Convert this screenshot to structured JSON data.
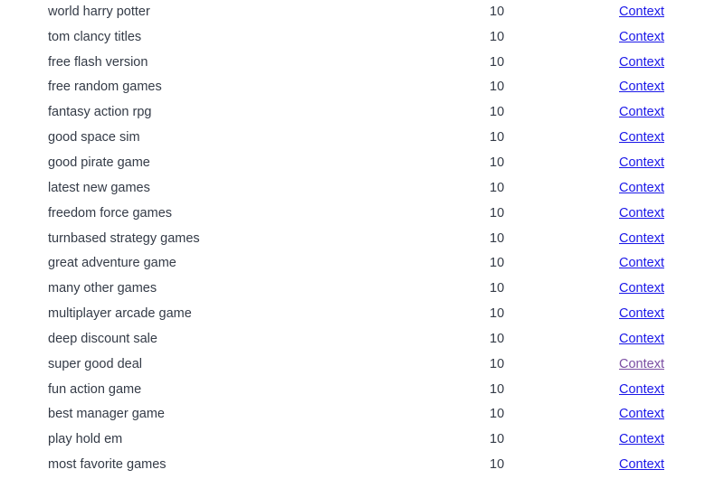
{
  "table": {
    "link_label": "Context",
    "link_color": "#1a17e8",
    "visited_link_color": "#7b4ea3",
    "text_color": "#343b47",
    "background_color": "#ffffff",
    "rows": [
      {
        "query": "world harry potter",
        "count": "10",
        "link": "Context",
        "visited": false
      },
      {
        "query": "tom clancy titles",
        "count": "10",
        "link": "Context",
        "visited": false
      },
      {
        "query": "free flash version",
        "count": "10",
        "link": "Context",
        "visited": false
      },
      {
        "query": "free random games",
        "count": "10",
        "link": "Context",
        "visited": false
      },
      {
        "query": "fantasy action rpg",
        "count": "10",
        "link": "Context",
        "visited": false
      },
      {
        "query": "good space sim",
        "count": "10",
        "link": "Context",
        "visited": false
      },
      {
        "query": "good pirate game",
        "count": "10",
        "link": "Context",
        "visited": false
      },
      {
        "query": "latest new games",
        "count": "10",
        "link": "Context",
        "visited": false
      },
      {
        "query": "freedom force games",
        "count": "10",
        "link": "Context",
        "visited": false
      },
      {
        "query": "turnbased strategy games",
        "count": "10",
        "link": "Context",
        "visited": false
      },
      {
        "query": "great adventure game",
        "count": "10",
        "link": "Context",
        "visited": false
      },
      {
        "query": "many other games",
        "count": "10",
        "link": "Context",
        "visited": false
      },
      {
        "query": "multiplayer arcade game",
        "count": "10",
        "link": "Context",
        "visited": false
      },
      {
        "query": "deep discount sale",
        "count": "10",
        "link": "Context",
        "visited": false
      },
      {
        "query": "super good deal",
        "count": "10",
        "link": "Context",
        "visited": true
      },
      {
        "query": "fun action game",
        "count": "10",
        "link": "Context",
        "visited": false
      },
      {
        "query": "best manager game",
        "count": "10",
        "link": "Context",
        "visited": false
      },
      {
        "query": "play hold em",
        "count": "10",
        "link": "Context",
        "visited": false
      },
      {
        "query": "most favorite games",
        "count": "10",
        "link": "Context",
        "visited": false
      }
    ]
  }
}
